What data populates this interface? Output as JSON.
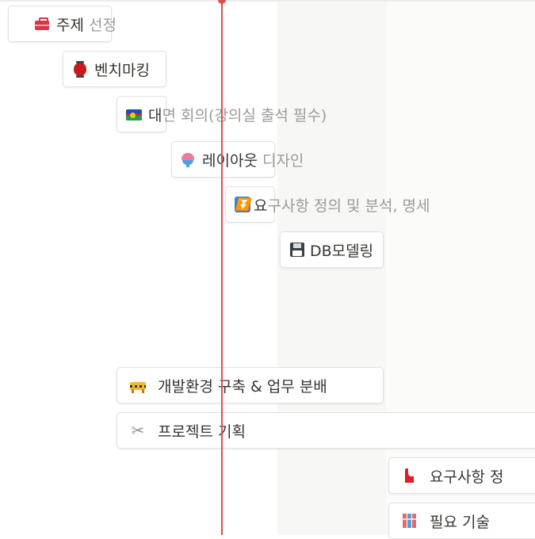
{
  "timeline": {
    "rows": [
      {
        "icon": "toolbox-icon",
        "label_in": "주제",
        "label_out": " 선정"
      },
      {
        "icon": "red-lantern-icon",
        "label_in": "벤치마킹",
        "label_out": ""
      },
      {
        "icon": "new-caledonia-flag-icon",
        "label_in": "대",
        "label_out": "면 회의(강의실 출석 필수)"
      },
      {
        "icon": "shaved-ice-icon",
        "label_in": "레이아웃",
        "label_out": " 디자인"
      },
      {
        "icon": "down-arrow-button-icon",
        "label_in": "요",
        "label_out": "구사항 정의 및 분석, 명세"
      },
      {
        "icon": "floppy-disk-icon",
        "label_in": "DB모델링",
        "label_out": ""
      },
      {
        "icon": "construction-icon",
        "label_in": "개발환경 구축 & 업무 분배",
        "label_out": ""
      },
      {
        "icon": "scissors-icon",
        "label_in": "프로젝트 기획",
        "label_out": ""
      },
      {
        "icon": "bookmark-icon",
        "label_in": "요구사항 정",
        "label_out": ""
      },
      {
        "icon": "books-icon",
        "label_in": "필요 기술",
        "label_out": ""
      }
    ]
  },
  "colors": {
    "today_line": "#e0504a",
    "card_border": "#e3e2e0",
    "text": "#37352f",
    "overflow_text": "#9b9a97"
  }
}
